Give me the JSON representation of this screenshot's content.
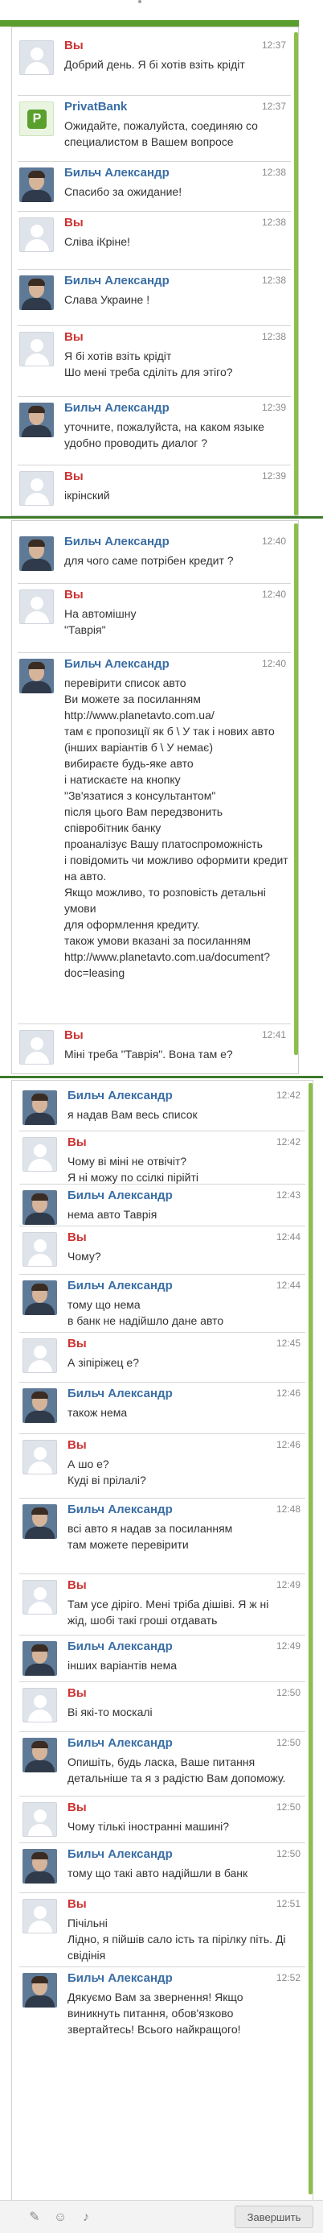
{
  "colors": {
    "user_name": "#cc3333",
    "agent_name": "#3a6ea5",
    "accent_green": "#5a9e2f"
  },
  "segment1": [
    {
      "sender": "user",
      "name": "Вы",
      "time": "12:37",
      "text": "Добрий день. Я бі хотів взіть крідіт"
    },
    {
      "sender": "bank",
      "name": "PrivatBank",
      "time": "12:37",
      "text": "Ожидайте, пожалуйста, соединяю со\nспециалистом в Вашем вопросе"
    },
    {
      "sender": "agent",
      "name": "Бильч Александр",
      "time": "12:38",
      "text": "Спасибо за ожидание!"
    },
    {
      "sender": "user",
      "name": "Вы",
      "time": "12:38",
      "text": "Сліва іКріне!"
    },
    {
      "sender": "agent",
      "name": "Бильч Александр",
      "time": "12:38",
      "text": "Слава Украине !"
    },
    {
      "sender": "user",
      "name": "Вы",
      "time": "12:38",
      "text": "Я бі хотів взіть крідіт\nШо мені треба сділіть для этіго?"
    },
    {
      "sender": "agent",
      "name": "Бильч Александр",
      "time": "12:39",
      "text": "уточните, пожалуйста, на каком языке\nудобно проводить диалог ?"
    },
    {
      "sender": "user",
      "name": "Вы",
      "time": "12:39",
      "text": "ікрінский"
    }
  ],
  "segment2": [
    {
      "sender": "agent",
      "name": "Бильч Александр",
      "time": "12:40",
      "text": "для чого саме потрібен кредит ?"
    },
    {
      "sender": "user",
      "name": "Вы",
      "time": "12:40",
      "text": "На автомішну\n\"Таврія\""
    },
    {
      "sender": "agent",
      "name": "Бильч Александр",
      "time": "12:40",
      "text": "перевірити список авто\nВи можете за посиланням\nhttp://www.planetavto.com.ua/\nтам є пропозиції як б \\ У так і нових авто\n(інших варіантів б \\ У немає)\nвибираєте будь-яке авто\nі натискаєте на кнопку\n\"Зв'язатися з консультантом\"\nпісля цього Вам передзвонить\nспівробітник банку\nпроаналізує Вашу платоспроможність\nі повідомить чи можливо оформити кредит\nна авто.\nЯкщо можливо, то розповість детальні\nумови\nдля оформлення кредиту.\nтакож умови вказані за посиланням\nhttp://www.planetavto.com.ua/document?\ndoc=leasing"
    },
    {
      "sender": "user",
      "name": "Вы",
      "time": "12:41",
      "text": "Міні треба \"Таврія\". Вона там е?"
    }
  ],
  "segment3": [
    {
      "sender": "agent",
      "name": "Бильч Александр",
      "time": "12:42",
      "text": "я надав Вам весь список"
    },
    {
      "sender": "user",
      "name": "Вы",
      "time": "12:42",
      "text": "Чому ві міні не отвічіт?\nЯ ні можу по ссілкі пірійті"
    },
    {
      "sender": "agent",
      "name": "Бильч Александр",
      "time": "12:43",
      "text": "нема авто Таврія"
    },
    {
      "sender": "user",
      "name": "Вы",
      "time": "12:44",
      "text": "Чому?"
    },
    {
      "sender": "agent",
      "name": "Бильч Александр",
      "time": "12:44",
      "text": "тому що нема\nв банк не надійшло дане авто"
    },
    {
      "sender": "user",
      "name": "Вы",
      "time": "12:45",
      "text": "А зіпіріжец е?"
    },
    {
      "sender": "agent",
      "name": "Бильч Александр",
      "time": "12:46",
      "text": "також нема"
    },
    {
      "sender": "user",
      "name": "Вы",
      "time": "12:46",
      "text": "А шо е?\nКуді ві прілалі?"
    },
    {
      "sender": "agent",
      "name": "Бильч Александр",
      "time": "12:48",
      "text": "всі авто я надав за посиланням\nтам можете перевірити"
    },
    {
      "sender": "user",
      "name": "Вы",
      "time": "12:49",
      "text": "Там усе діріго. Мені тріба дішіві. Я ж ні\nжід, шобі такі гроші отдавать"
    },
    {
      "sender": "agent",
      "name": "Бильч Александр",
      "time": "12:49",
      "text": "інших варіантів нема"
    },
    {
      "sender": "user",
      "name": "Вы",
      "time": "12:50",
      "text": "Ві які-то москалі"
    },
    {
      "sender": "agent",
      "name": "Бильч Александр",
      "time": "12:50",
      "text": "Опишіть, будь ласка, Ваше питання\nдетальніше та я з радістю Вам допоможу."
    },
    {
      "sender": "user",
      "name": "Вы",
      "time": "12:50",
      "text": "Чому тількі іностранні машині?"
    },
    {
      "sender": "agent",
      "name": "Бильч Александр",
      "time": "12:50",
      "text": "тому що такі авто надійшли в банк"
    },
    {
      "sender": "user",
      "name": "Вы",
      "time": "12:51",
      "text": "Пічільні\nЛідно, я пійшів сало ість та пірілку піть. Ді\nсвідінія"
    },
    {
      "sender": "agent",
      "name": "Бильч Александр",
      "time": "12:52",
      "text": "Дякуємо Вам за звернення! Якщо\nвиникнуть питання, обов'язково\nзвертайтесь! Всього найкращого!"
    }
  ],
  "composer": {
    "send_label": "Завершить",
    "icons": [
      "paperclip-icon",
      "smile-icon",
      "speaker-icon"
    ]
  }
}
